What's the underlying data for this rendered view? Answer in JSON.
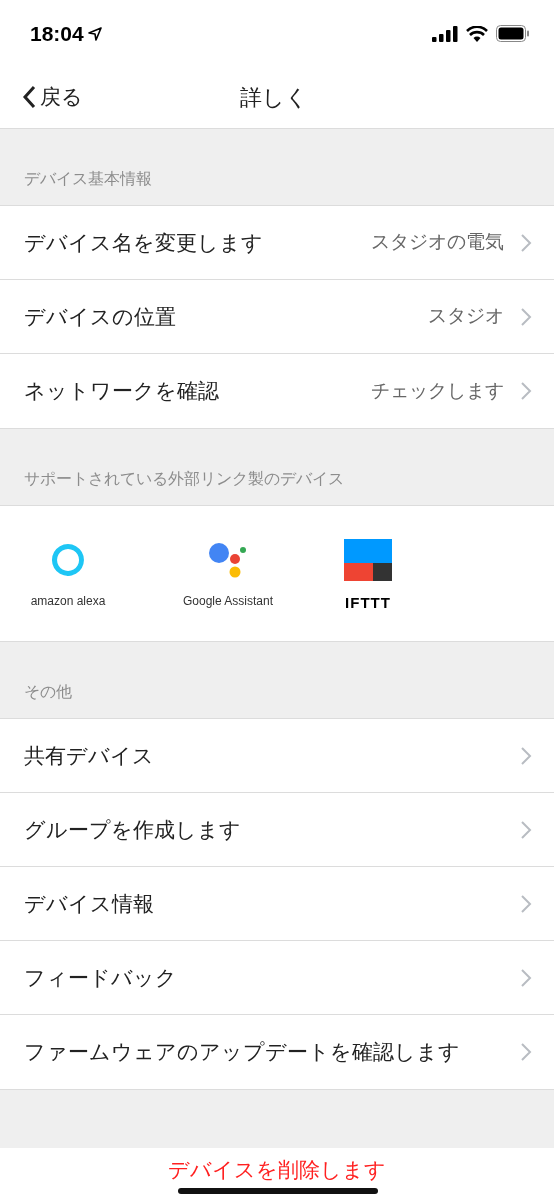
{
  "status_bar": {
    "time": "18:04"
  },
  "nav": {
    "back": "戻る",
    "title": "詳しく"
  },
  "basic_section": {
    "header": "デバイス基本情報",
    "rows": [
      {
        "label": "デバイス名を変更します",
        "value": "スタジオの電気"
      },
      {
        "label": "デバイスの位置",
        "value": "スタジオ"
      },
      {
        "label": "ネットワークを確認",
        "value": "チェックします"
      }
    ]
  },
  "integrations_section": {
    "header": "サポートされている外部リンク製のデバイス",
    "items": [
      {
        "kind": "alexa",
        "label": "amazon alexa"
      },
      {
        "kind": "google",
        "label": "Google Assistant"
      },
      {
        "kind": "ifttt",
        "label": "IFTTT"
      }
    ]
  },
  "other_section": {
    "header": "その他",
    "rows": [
      {
        "label": "共有デバイス"
      },
      {
        "label": "グループを作成します"
      },
      {
        "label": "デバイス情報"
      },
      {
        "label": "フィードバック"
      },
      {
        "label": "ファームウェアのアップデートを確認します"
      }
    ]
  },
  "delete_button": "デバイスを削除します"
}
